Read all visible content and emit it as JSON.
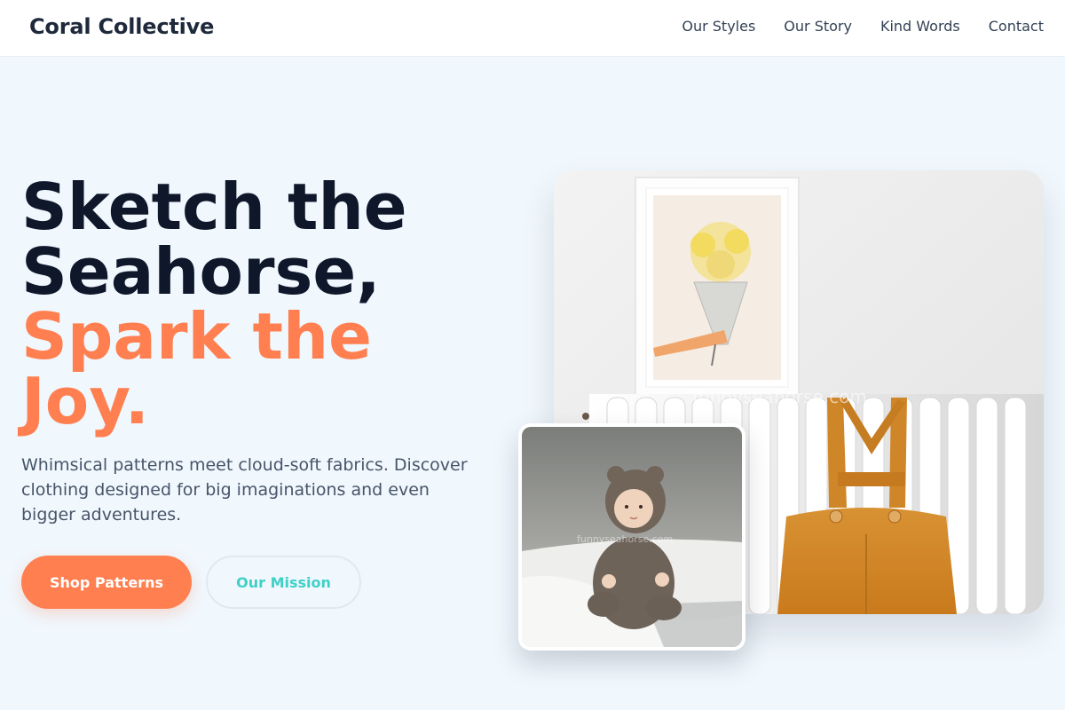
{
  "header": {
    "brand": "Coral Collective",
    "nav": [
      "Our Styles",
      "Our Story",
      "Kind Words",
      "Contact"
    ]
  },
  "hero": {
    "title_line1": "Sketch the",
    "title_line2": "Seahorse,",
    "title_line3": "Spark the",
    "title_line4": "Joy.",
    "subtitle": "Whimsical patterns meet cloud-soft fabrics. Discover clothing designed for big imaginations and even bigger adventures.",
    "primary_cta": "Shop Patterns",
    "secondary_cta": "Our Mission"
  },
  "images": {
    "main_watermark": "funnyseahorse.com",
    "small_watermark": "funnyseahorse.com"
  },
  "colors": {
    "accent": "#ff7f50",
    "teal": "#40d0c8",
    "dark": "#0f172a",
    "background": "#f0f7fd"
  }
}
